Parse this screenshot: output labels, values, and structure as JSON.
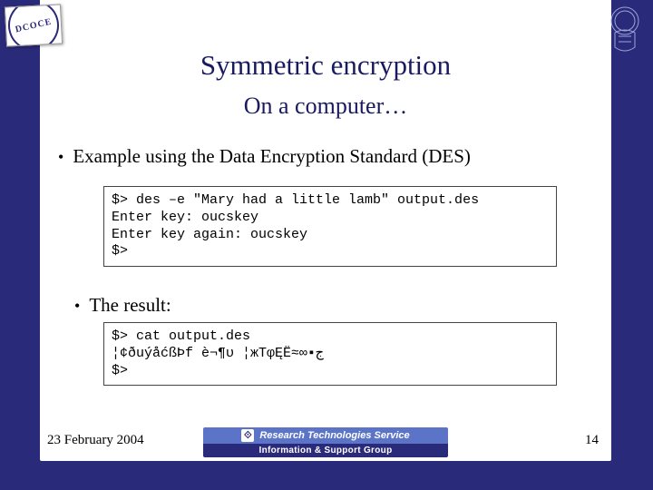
{
  "logo_left_text": "DCOCE",
  "title": "Symmetric encryption",
  "subtitle": "On a computer…",
  "bullets": {
    "b1": "Example using the Data Encryption Standard (DES)",
    "b2": "The result:"
  },
  "code1": "$> des –e \"Mary had a little lamb\" output.des\nEnter key: oucskey\nEnter key again: oucskey\n$>",
  "code2": "$> cat output.des\n¦¢ðuýåćßÞf è¬¶υ ¦жTφĘË≈∞▪ج\n$>",
  "footer": {
    "date": "23 February 2004",
    "page": "14",
    "banner_top": "Research Technologies Service",
    "banner_bottom": "Information & Support Group"
  }
}
